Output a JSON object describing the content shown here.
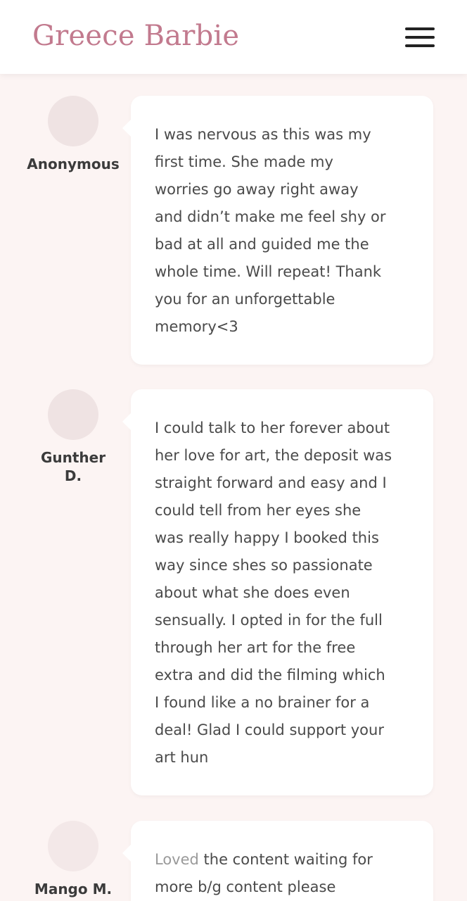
{
  "header": {
    "logo": "Greece Barbie",
    "menu_icon": "hamburger-menu-icon"
  },
  "reviews": [
    {
      "name": "Anonymous",
      "text": "I was nervous as this was my\nfirst time. She made my\nworries go away right away\nand didn’t make me feel shy or\nbad at all and guided me the\nwhole time. Will repeat! Thank\nyou for an unforgettable\nmemory<3"
    },
    {
      "name": "Gunther\nD.",
      "text": "I could talk to her forever about\nher love for art, the deposit was\nstraight forward and easy and I\ncould tell from her eyes she\nwas really happy I booked this\nway since shes so passionate\nabout what she does even\nsensually. I opted in for the full\nthrough her art for the free\nextra and did the filming which\nI found like a no brainer for a\ndeal! Glad I could support your\nart hun"
    },
    {
      "name": "Mango M.",
      "text_faded": "Loved",
      "text": " the content waiting for\nmore b/g content please"
    }
  ],
  "colors": {
    "brand": "#c27a8e",
    "page_bg": "#fcf4f3",
    "card_bg": "#ffffff",
    "avatar_bg": "#efe3e3"
  }
}
